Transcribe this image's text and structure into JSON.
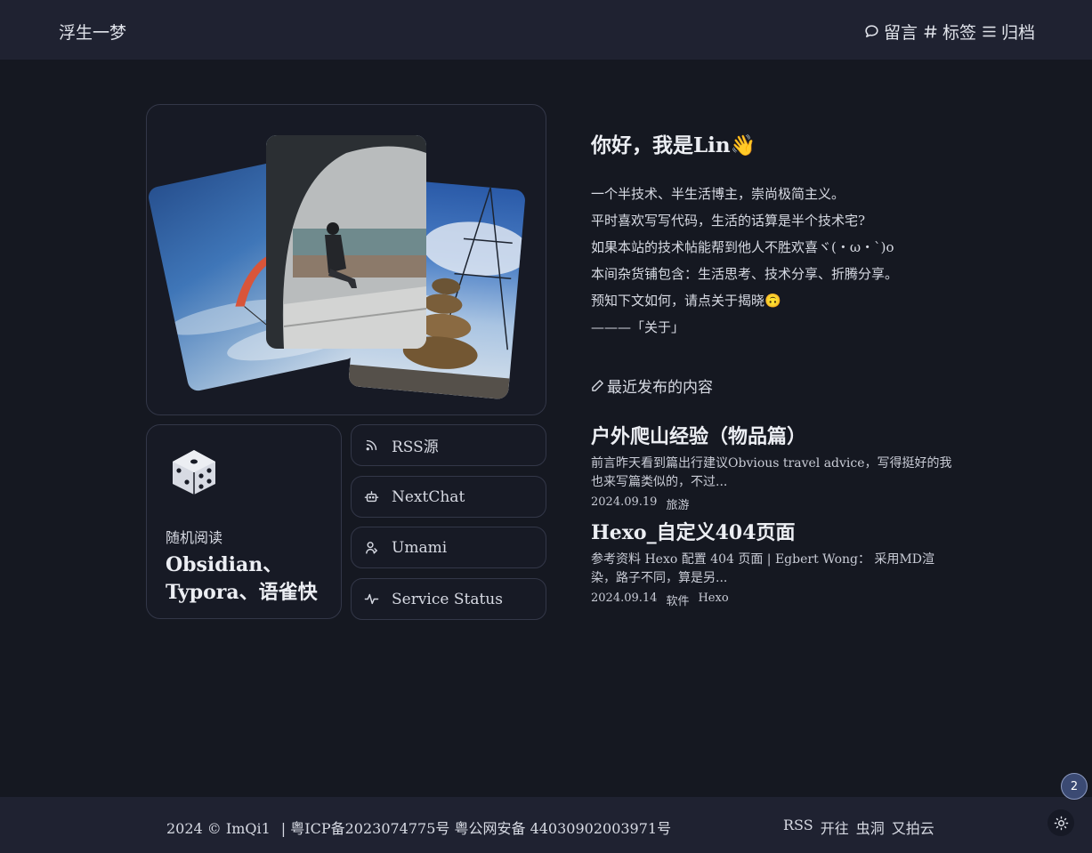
{
  "header": {
    "site_title": "浮生一梦",
    "nav": [
      {
        "label": "留言",
        "icon": "message-icon"
      },
      {
        "label": "标签",
        "icon": "hash-icon"
      },
      {
        "label": "归档",
        "icon": "list-icon"
      }
    ]
  },
  "random": {
    "label": "随机阅读",
    "title": "Obsidian、Typora、语雀快"
  },
  "links": [
    {
      "label": "RSS源",
      "icon": "rss-icon"
    },
    {
      "label": "NextChat",
      "icon": "robot-icon"
    },
    {
      "label": "Umami",
      "icon": "user-icon"
    },
    {
      "label": "Service Status",
      "icon": "pulse-icon"
    }
  ],
  "intro": {
    "greeting": "你好，我是Lin👋",
    "lines": [
      "一个半技术、半生活博主，崇尚极简主义。",
      "平时喜欢写写代码，生活的话算是半个技术宅?",
      "如果本站的技术帖能帮到他人不胜欢喜ヾ(・ω・`)o",
      "本间杂货铺包含：生活思考、技术分享、折腾分享。",
      "预知下文如何，请点关于揭晓🙃",
      "———「关于」"
    ]
  },
  "recent": {
    "heading": "最近发布的内容",
    "posts": [
      {
        "title": "户外爬山经验（物品篇）",
        "excerpt": "前言昨天看到篇出行建议Obvious travel advice，写得挺好的我也来写篇类似的，不过...",
        "date": "2024.09.19",
        "tags": [
          "旅游"
        ]
      },
      {
        "title": "Hexo_自定义404页面",
        "excerpt": "参考资料 Hexo 配置 404 页面 | Egbert Wong： 采用MD渲染，路子不同，算是另...",
        "date": "2024.09.14",
        "tags": [
          "软件",
          "Hexo"
        ]
      }
    ]
  },
  "footer": {
    "copyright": "2024 © ImQi1",
    "icp": "| 粤ICP备2023074775号 粤公网安备 44030902003971号",
    "links": [
      "RSS",
      "开往",
      "虫洞",
      "又拍云"
    ]
  },
  "badge_count": "2",
  "colors": {
    "background": "#151821",
    "header_bg": "#1f2231",
    "card_border": "#333748",
    "text": "#d7dae3"
  }
}
